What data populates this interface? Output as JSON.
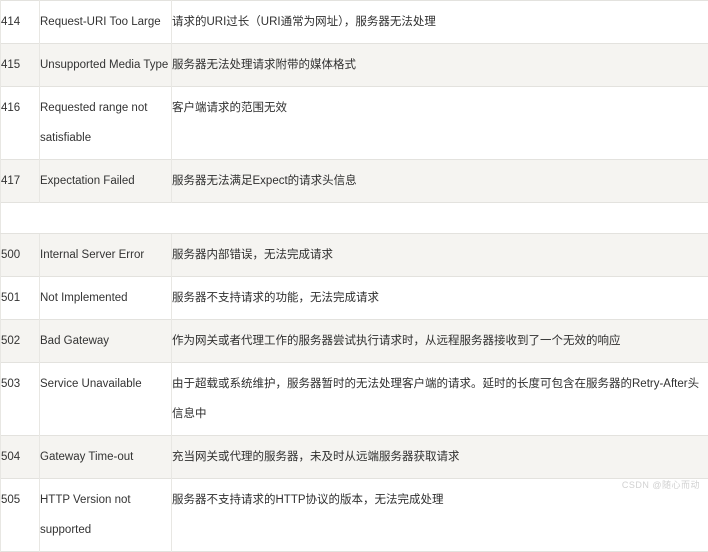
{
  "table": {
    "columns": [
      "code",
      "name",
      "description"
    ],
    "rows": [
      {
        "type": "data",
        "shade": "plain",
        "code": "414",
        "name": "Request-URI Too Large",
        "description": "请求的URI过长（URI通常为网址），服务器无法处理"
      },
      {
        "type": "data",
        "shade": "shade",
        "code": "415",
        "name": "Unsupported Media Type",
        "description": "服务器无法处理请求附带的媒体格式"
      },
      {
        "type": "data",
        "shade": "plain",
        "code": "416",
        "name": "Requested range not satisfiable",
        "description": "客户端请求的范围无效"
      },
      {
        "type": "data",
        "shade": "shade",
        "code": "417",
        "name": "Expectation Failed",
        "description": "服务器无法满足Expect的请求头信息"
      },
      {
        "type": "spacer",
        "shade": "plain",
        "code": "",
        "name": "",
        "description": ""
      },
      {
        "type": "data",
        "shade": "shade",
        "code": "500",
        "name": "Internal Server Error",
        "description": "服务器内部错误，无法完成请求"
      },
      {
        "type": "data",
        "shade": "plain",
        "code": "501",
        "name": "Not Implemented",
        "description": "服务器不支持请求的功能，无法完成请求"
      },
      {
        "type": "data",
        "shade": "shade",
        "code": "502",
        "name": "Bad Gateway",
        "description": "作为网关或者代理工作的服务器尝试执行请求时，从远程服务器接收到了一个无效的响应"
      },
      {
        "type": "data",
        "shade": "plain",
        "code": "503",
        "name": "Service Unavailable",
        "description": "由于超载或系统维护，服务器暂时的无法处理客户端的请求。延时的长度可包含在服务器的Retry-After头信息中"
      },
      {
        "type": "data",
        "shade": "shade",
        "code": "504",
        "name": "Gateway Time-out",
        "description": "充当网关或代理的服务器，未及时从远端服务器获取请求"
      },
      {
        "type": "data",
        "shade": "plain",
        "code": "505",
        "name": "HTTP Version not supported",
        "description": "服务器不支持请求的HTTP协议的版本，无法完成处理"
      }
    ]
  },
  "watermark": {
    "text": "CSDN @随心而动"
  },
  "colors": {
    "row_shade": "#f5f4f1",
    "row_plain": "#ffffff",
    "border": "#e3e2de",
    "text": "#2b2b2b"
  }
}
